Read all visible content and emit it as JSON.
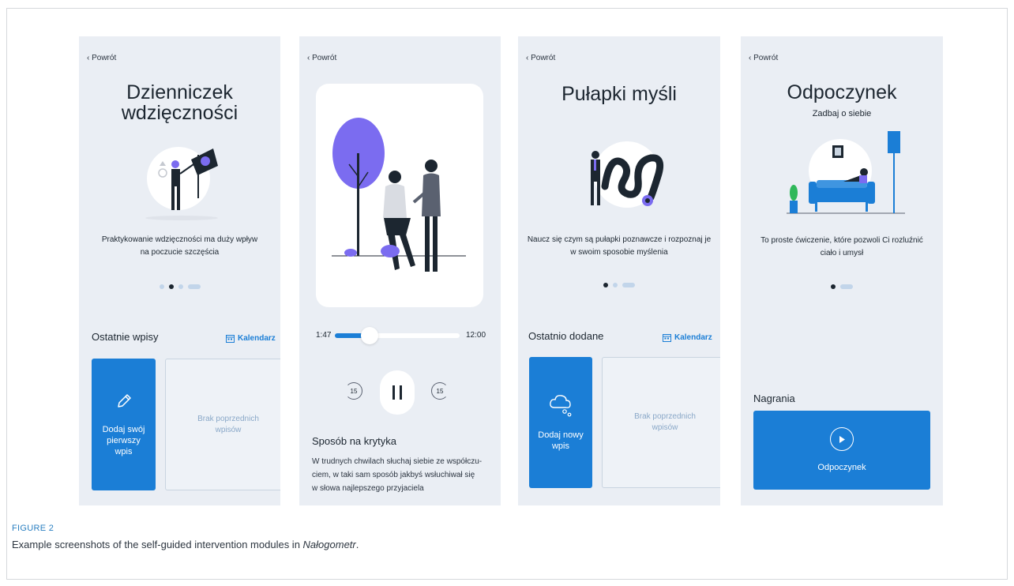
{
  "screen1": {
    "back": "‹ Powrót",
    "title_line1": "Dzienniczek",
    "title_line2": "wdzięczności",
    "desc_line1": "Praktykowanie wdzięczności ma duży wpływ",
    "desc_line2": "na poczucie szczęścia",
    "section": "Ostatnie wpisy",
    "calendar": "Kalendarz",
    "add_card": "Dodaj swój pierwszy wpis",
    "empty_card": "Brak poprzednich wpisów"
  },
  "screen2": {
    "back": "‹ Powrót",
    "time_current": "1:47",
    "time_total": "12:00",
    "progress": 0.27,
    "skip_back": "15",
    "skip_forward": "15",
    "track_title": "Sposób na krytyka",
    "track_desc_line1": "W trudnych chwilach słuchaj siebie ze współczu-",
    "track_desc_line2": "ciem, w taki sam sposób jakbyś wsłuchiwał się",
    "track_desc_line3": "w słowa najlepszego przyjaciela"
  },
  "screen3": {
    "back": "‹ Powrót",
    "title": "Pułapki myśli",
    "desc_line1": "Naucz się czym są pułapki poznawcze i rozpoznaj je",
    "desc_line2": "w swoim sposobie myślenia",
    "section": "Ostatnio dodane",
    "calendar": "Kalendarz",
    "add_card": "Dodaj nowy wpis",
    "empty_card": "Brak poprzednich wpisów"
  },
  "screen4": {
    "back": "‹ Powrót",
    "title": "Odpoczynek",
    "subtitle": "Zadbaj o siebie",
    "desc_line1": "To proste ćwiczenie, które pozwoli Ci rozluźnić",
    "desc_line2": "ciało i umysł",
    "section": "Nagrania",
    "recording": "Odpoczynek"
  },
  "caption": {
    "label": "FIGURE 2",
    "text_before": "Example screenshots of the self-guided intervention modules in ",
    "app_name": "Nałogometr",
    "text_after": "."
  },
  "colors": {
    "accent": "#1b7ed6",
    "screen_bg": "#eaeef4",
    "illustration_purple": "#7b6cf0"
  }
}
